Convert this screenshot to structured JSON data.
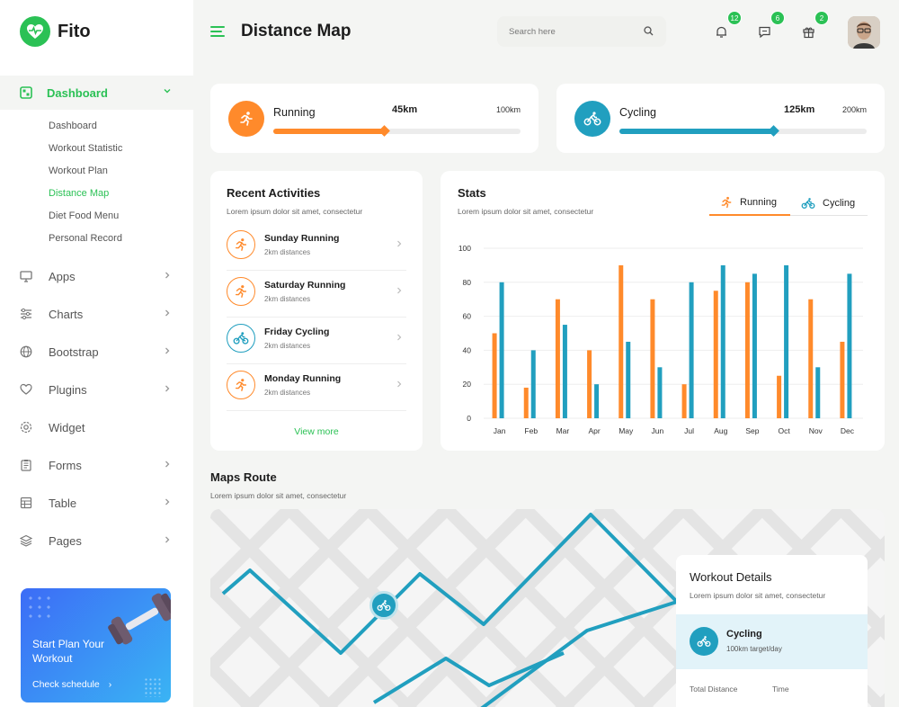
{
  "brand": {
    "name": "Fito"
  },
  "colors": {
    "green": "#2bc155",
    "orange": "#ff8a2b",
    "teal": "#219fbf"
  },
  "sidebar": {
    "active": {
      "label": "Dashboard",
      "icon": "dashboard-icon"
    },
    "subitems": [
      "Dashboard",
      "Workout Statistic",
      "Workout Plan",
      "Distance Map",
      "Diet Food Menu",
      "Personal Record"
    ],
    "current_subitem": "Distance Map",
    "items": [
      {
        "label": "Apps",
        "icon": "monitor-icon",
        "has_arrow": true
      },
      {
        "label": "Charts",
        "icon": "sliders-icon",
        "has_arrow": true
      },
      {
        "label": "Bootstrap",
        "icon": "globe-icon",
        "has_arrow": true
      },
      {
        "label": "Plugins",
        "icon": "heart-icon",
        "has_arrow": true
      },
      {
        "label": "Widget",
        "icon": "settings-icon",
        "has_arrow": false
      },
      {
        "label": "Forms",
        "icon": "clipboard-icon",
        "has_arrow": true
      },
      {
        "label": "Table",
        "icon": "table-icon",
        "has_arrow": true
      },
      {
        "label": "Pages",
        "icon": "layers-icon",
        "has_arrow": true
      }
    ],
    "promo": {
      "title": "Start Plan Your Workout",
      "button": "Check schedule"
    }
  },
  "header": {
    "title": "Distance Map",
    "search_placeholder": "Search here",
    "notifications": {
      "bell": "12",
      "chat": "6",
      "gift": "2"
    }
  },
  "running": {
    "name": "Running",
    "value": "45km",
    "max": "100km",
    "fraction": 0.45
  },
  "cycling": {
    "name": "Cycling",
    "value": "125km",
    "max": "200km",
    "fraction": 0.625
  },
  "recent": {
    "title": "Recent Activities",
    "subtitle": "Lorem ipsum dolor sit amet, consectetur",
    "items": [
      {
        "name": "Sunday Running",
        "desc": "2km distances",
        "type": "run"
      },
      {
        "name": "Saturday Running",
        "desc": "2km distances",
        "type": "run"
      },
      {
        "name": "Friday Cycling",
        "desc": "2km distances",
        "type": "bike"
      },
      {
        "name": "Monday Running",
        "desc": "2km distances",
        "type": "run"
      }
    ],
    "view_more": "View more"
  },
  "stats": {
    "title": "Stats",
    "subtitle": "Lorem ipsum dolor sit amet, consectetur",
    "tabs": [
      "Running",
      "Cycling"
    ],
    "active_tab": "Running"
  },
  "chart_data": {
    "type": "bar",
    "categories": [
      "Jan",
      "Feb",
      "Mar",
      "Apr",
      "May",
      "Jun",
      "Jul",
      "Aug",
      "Sep",
      "Oct",
      "Nov",
      "Dec"
    ],
    "series": [
      {
        "name": "Running",
        "color": "#ff8a2b",
        "values": [
          50,
          18,
          70,
          40,
          90,
          70,
          20,
          75,
          80,
          25,
          70,
          45
        ]
      },
      {
        "name": "Cycling",
        "color": "#219fbf",
        "values": [
          80,
          40,
          55,
          20,
          45,
          30,
          80,
          90,
          85,
          90,
          30,
          85
        ]
      }
    ],
    "yticks": [
      "0",
      "20",
      "40",
      "60",
      "80",
      "100"
    ],
    "ylim": [
      0,
      100
    ],
    "grid": true
  },
  "maps": {
    "title": "Maps Route",
    "subtitle": "Lorem ipsum dolor sit amet, consectetur"
  },
  "workout_details": {
    "title": "Workout Details",
    "subtitle": "Lorem ipsum dolor sit amet, consectetur",
    "activity": "Cycling",
    "target": "100km target/day",
    "total_label": "Total Distance",
    "time_label": "Time"
  }
}
